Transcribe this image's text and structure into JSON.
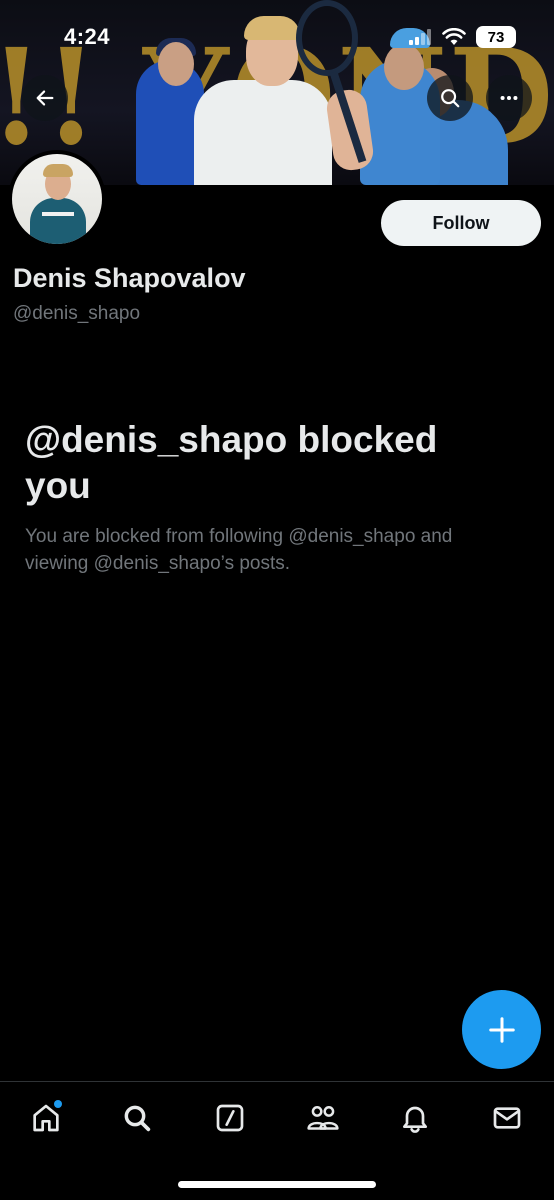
{
  "status_bar": {
    "time": "4:24",
    "battery": "73"
  },
  "banner": {
    "backdrop_text": "!! YONDRA"
  },
  "profile": {
    "display_name": "Denis Shapovalov",
    "handle": "@denis_shapo",
    "follow_label": "Follow"
  },
  "blocked_notice": {
    "title": "@denis_shapo blocked you",
    "description": "You are blocked from following @denis_shapo and viewing @denis_shapo’s posts."
  },
  "header_actions": {
    "back_icon": "arrow-left-icon",
    "search_icon": "search-icon",
    "more_icon": "more-horizontal-icon"
  },
  "fab": {
    "icon": "plus-icon"
  },
  "tab_bar": {
    "items": [
      {
        "name": "home",
        "icon": "home-icon",
        "has_notification": true
      },
      {
        "name": "search",
        "icon": "search-icon",
        "has_notification": false
      },
      {
        "name": "grok",
        "icon": "slash-square-icon",
        "has_notification": false
      },
      {
        "name": "communities",
        "icon": "people-icon",
        "has_notification": false
      },
      {
        "name": "notifications",
        "icon": "bell-icon",
        "has_notification": false
      },
      {
        "name": "messages",
        "icon": "envelope-icon",
        "has_notification": false
      }
    ]
  },
  "colors": {
    "accent": "#1d9bf0",
    "background": "#000000",
    "primary_text": "#e7e9ea",
    "secondary_text": "#71767b",
    "follow_button_bg": "#eff3f4"
  }
}
